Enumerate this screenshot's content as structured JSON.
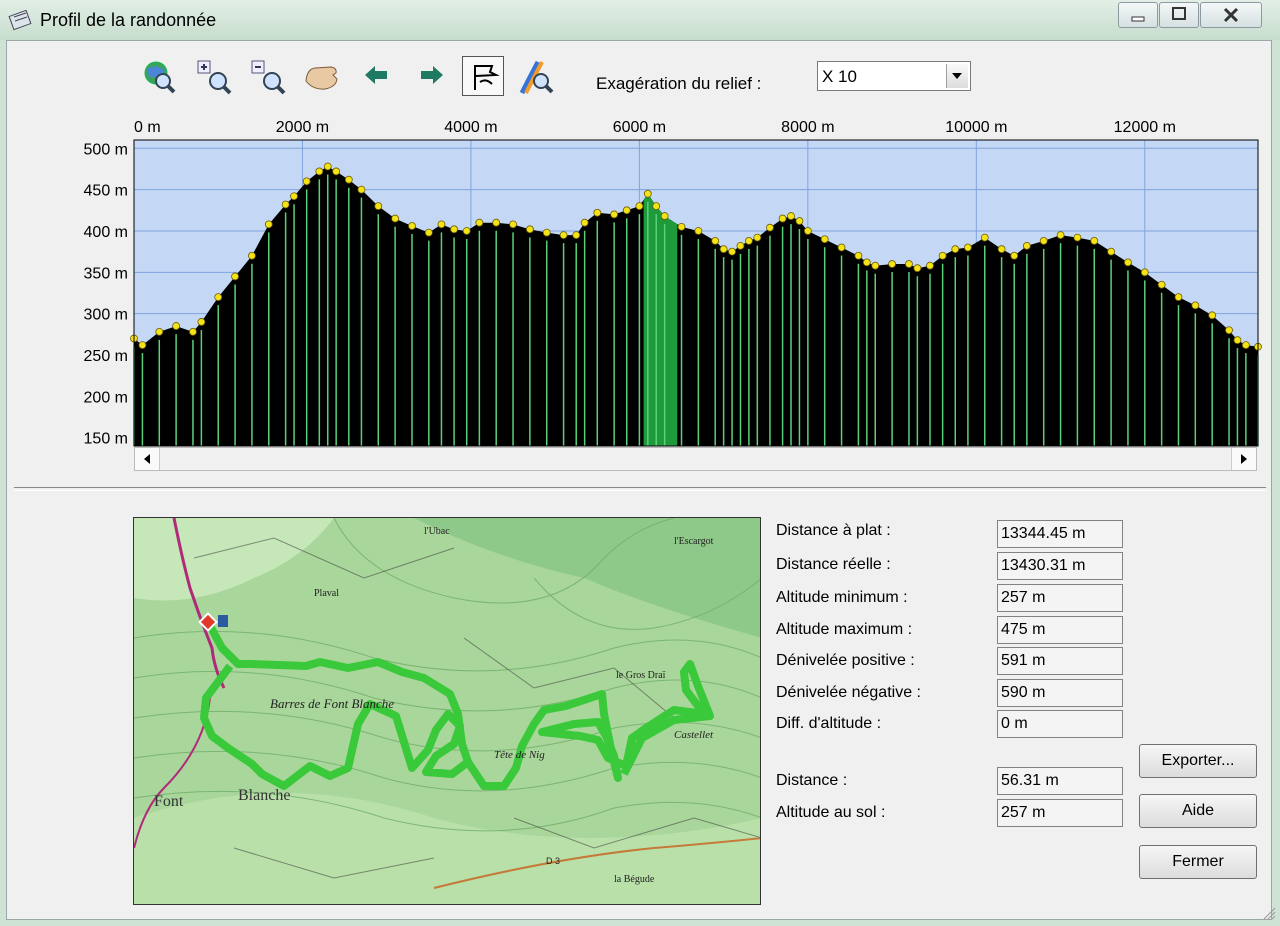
{
  "window": {
    "title": "Profil de la randonnée"
  },
  "toolbar": {
    "icons": [
      "zoom-globe-icon",
      "zoom-in-icon",
      "zoom-out-icon",
      "hand-pan-icon",
      "arrow-left-icon",
      "arrow-right-icon",
      "route-flag-icon",
      "road-zoom-icon"
    ],
    "relief_label": "Exagération du relief :",
    "relief_value": "X 10"
  },
  "chart_data": {
    "type": "area",
    "x_ticks": [
      "0 m",
      "2000 m",
      "4000 m",
      "6000 m",
      "8000 m",
      "10000 m",
      "12000 m"
    ],
    "y_ticks": [
      "500 m",
      "450 m",
      "400 m",
      "350 m",
      "300 m",
      "250 m",
      "200 m",
      "150 m"
    ],
    "xlim": [
      0,
      13344
    ],
    "ylim": [
      140,
      510
    ],
    "grid": true,
    "colors": {
      "sky": "#c4d8f5",
      "fill": "#000000",
      "highlight": "#1e9a3a",
      "bars": "#5bd07a",
      "points": "#f5e31a",
      "grid": "#7fa4dc"
    },
    "x": [
      0,
      100,
      300,
      500,
      700,
      800,
      1000,
      1200,
      1400,
      1600,
      1800,
      1900,
      2050,
      2200,
      2300,
      2400,
      2550,
      2700,
      2900,
      3100,
      3300,
      3500,
      3650,
      3800,
      3950,
      4100,
      4300,
      4500,
      4700,
      4900,
      5100,
      5250,
      5350,
      5500,
      5700,
      5850,
      6000,
      6100,
      6200,
      6300,
      6500,
      6700,
      6900,
      7000,
      7100,
      7200,
      7300,
      7400,
      7550,
      7700,
      7800,
      7900,
      8000,
      8200,
      8400,
      8600,
      8700,
      8800,
      9000,
      9200,
      9300,
      9450,
      9600,
      9750,
      9900,
      10100,
      10300,
      10450,
      10600,
      10800,
      11000,
      11200,
      11400,
      11600,
      11800,
      12000,
      12200,
      12400,
      12600,
      12800,
      13000,
      13100,
      13200,
      13344
    ],
    "y": [
      270,
      262,
      278,
      285,
      278,
      290,
      320,
      345,
      370,
      408,
      432,
      442,
      460,
      472,
      478,
      472,
      462,
      450,
      430,
      415,
      406,
      398,
      408,
      402,
      400,
      410,
      410,
      408,
      402,
      398,
      395,
      395,
      410,
      422,
      420,
      425,
      430,
      445,
      430,
      418,
      405,
      400,
      388,
      378,
      375,
      382,
      388,
      392,
      404,
      415,
      418,
      412,
      400,
      390,
      380,
      370,
      362,
      358,
      360,
      360,
      355,
      358,
      370,
      378,
      380,
      392,
      378,
      370,
      382,
      388,
      395,
      392,
      388,
      375,
      362,
      350,
      335,
      320,
      310,
      298,
      280,
      268,
      262,
      260
    ],
    "highlight_range": [
      6050,
      6450
    ]
  },
  "stats": {
    "distance_plat": {
      "label": "Distance à plat :",
      "value": "13344.45 m"
    },
    "distance_reelle": {
      "label": "Distance réelle :",
      "value": "13430.31 m"
    },
    "altitude_min": {
      "label": "Altitude minimum :",
      "value": "257 m"
    },
    "altitude_max": {
      "label": "Altitude maximum :",
      "value": "475 m"
    },
    "denivele_pos": {
      "label": "Dénivelée positive :",
      "value": "591 m"
    },
    "denivele_neg": {
      "label": "Dénivelée négative :",
      "value": "590 m"
    },
    "diff_altitude": {
      "label": "Diff. d'altitude :",
      "value": "0 m"
    },
    "distance": {
      "label": "Distance :",
      "value": "56.31 m"
    },
    "altitude_sol": {
      "label": "Altitude au sol :",
      "value": "257 m"
    }
  },
  "buttons": {
    "export": "Exporter...",
    "help": "Aide",
    "close": "Fermer"
  },
  "map": {
    "labels": [
      "Barres de Font Blanche",
      "Font",
      "Blanche",
      "Tête de Nig",
      "Castellet",
      "Plaval",
      "l'Escargot",
      "le Gros Draï",
      "la Bégude",
      "D 3",
      "l'Ubac"
    ]
  }
}
